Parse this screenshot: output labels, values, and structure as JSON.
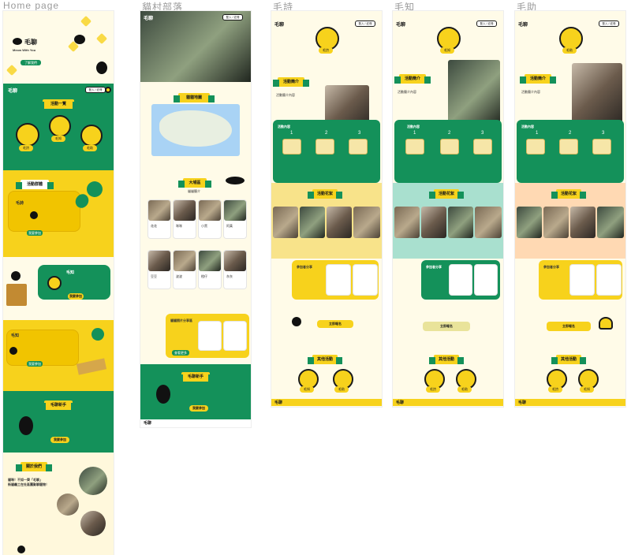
{
  "frames": {
    "home": "Home page",
    "village": "貓村部落",
    "maoshi": "毛詩",
    "maozhi": "毛知",
    "maozhu": "毛助"
  },
  "home": {
    "hero_logo": "毛聊",
    "hero_tagline": "Meow With You",
    "hero_button": "了解我們",
    "nav_logo": "毛聊",
    "nav_button": "登入 / 註冊",
    "intro_ribbon": "活動一覽",
    "intro_items": [
      "毛詩",
      "毛知",
      "毛助"
    ],
    "about_ribbon": "活動群體",
    "section_shi_title": "毛詩",
    "section_shi_button": "我要參加",
    "section_zhi_title": "毛知",
    "section_zhi_button": "我要參加",
    "section_zhu_title": "毛知",
    "section_zhu_button": "我要參加",
    "newbie_ribbon": "毛聊新手",
    "newbie_button": "我要參加",
    "about_us_ribbon": "關於我們",
    "about_us_head1": "貓咪！不如一齊「毛聊」",
    "about_us_head2": "街貓義工在社區團聚聊寵物！"
  },
  "village": {
    "nav_button": "登入 / 註冊",
    "map_ribbon": "貓貓地圖",
    "list_ribbon": "大埔區",
    "list_sub": "貓貓簡介",
    "share_title": "貓貓照片分享區",
    "share_button": "查看更多",
    "newbie_ribbon": "毛聊新手",
    "newbie_button": "我要參加",
    "cat_names": [
      "花花",
      "咪咪",
      "小黑",
      "阿黃",
      "豆豆",
      "波波",
      "橙仔",
      "灰灰"
    ],
    "footer_logo": "毛聊"
  },
  "maoshi": {
    "nav_button": "登入 / 註冊",
    "badge": "毛詩",
    "about_ribbon": "活動簡介",
    "content_title": "活動內容",
    "steps": [
      "1",
      "2",
      "3"
    ],
    "gallery_ribbon": "活動花絮",
    "share_title": "參加者分享",
    "cta_button": "立即報名",
    "other_ribbon": "其他活動",
    "other_items": [
      "毛知",
      "毛助"
    ],
    "footer_logo": "毛聊"
  },
  "maozhi": {
    "nav_button": "登入 / 註冊",
    "badge": "毛知",
    "about_ribbon": "活動簡介",
    "content_title": "活動內容",
    "steps": [
      "1",
      "2",
      "3"
    ],
    "gallery_ribbon": "活動花絮",
    "share_title": "參加者分享",
    "cta_button": "立即報名",
    "other_ribbon": "其他活動",
    "other_items": [
      "毛詩",
      "毛助"
    ],
    "footer_logo": "毛聊"
  },
  "maozhu": {
    "nav_button": "登入 / 註冊",
    "badge": "毛助",
    "about_ribbon": "活動簡介",
    "content_title": "活動內容",
    "steps": [
      "1",
      "2",
      "3"
    ],
    "gallery_ribbon": "活動花絮",
    "share_title": "參加者分享",
    "cta_button": "立即報名",
    "other_ribbon": "其他活動",
    "other_items": [
      "毛詩",
      "毛知"
    ],
    "footer_logo": "毛聊"
  },
  "colors": {
    "green": "#14915a",
    "yellow": "#f7d21c",
    "cream": "#fff8dc",
    "ink": "#1b1b1b"
  }
}
